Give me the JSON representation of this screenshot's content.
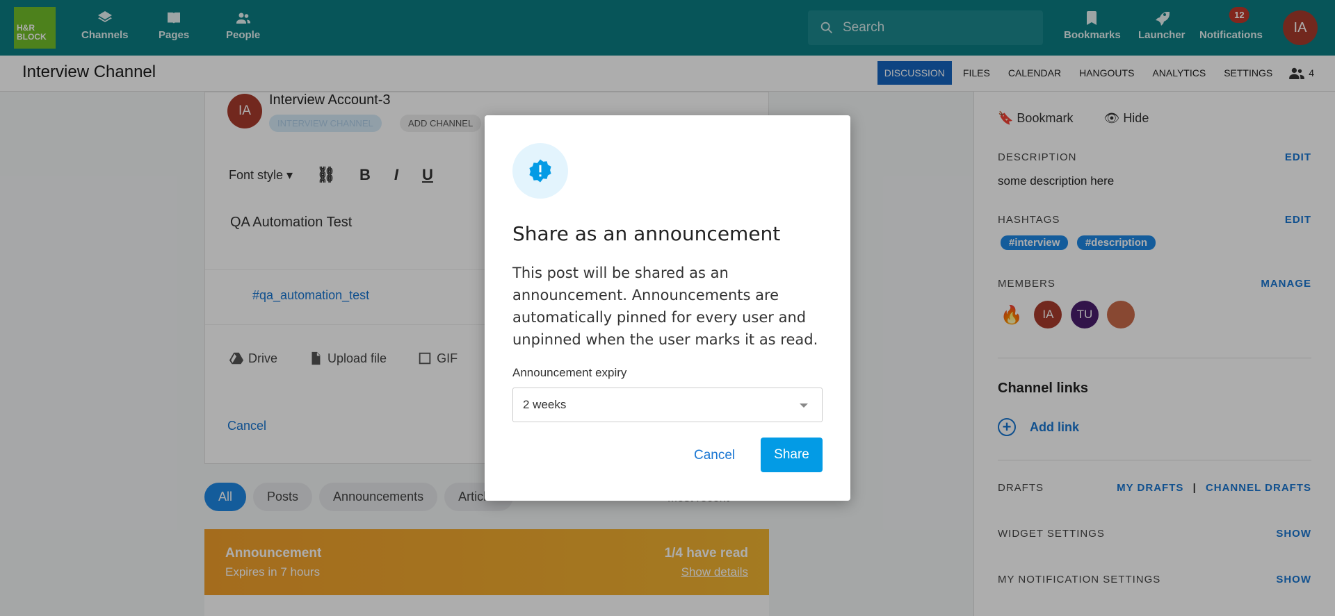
{
  "topbar": {
    "logo_line1": "H&R",
    "logo_line2": "BLOCK",
    "nav": [
      {
        "label": "Channels",
        "icon": "layers-icon"
      },
      {
        "label": "Pages",
        "icon": "book-icon"
      },
      {
        "label": "People",
        "icon": "people-icon"
      }
    ],
    "search_placeholder": "Search",
    "right_nav": [
      {
        "label": "Bookmarks",
        "icon": "bookmark-icon"
      },
      {
        "label": "Launcher",
        "icon": "rocket-icon"
      },
      {
        "label": "Notifications",
        "icon": "bell-icon",
        "badge": "12"
      }
    ],
    "user_initials": "IA"
  },
  "channel": {
    "title": "Interview Channel",
    "tabs": [
      "DISCUSSION",
      "FILES",
      "CALENDAR",
      "HANGOUTS",
      "ANALYTICS",
      "SETTINGS"
    ],
    "active_tab": "DISCUSSION",
    "member_count": "4"
  },
  "composer": {
    "author_initials": "IA",
    "author_name": "Interview Account-3",
    "chip_channel": "INTERVIEW CHANNEL",
    "chip_add": "ADD CHANNEL",
    "font_style": "Font style",
    "text": "QA Automation Test",
    "hashtag": "#qa_automation_test",
    "attachments": [
      "Drive",
      "Upload file",
      "GIF"
    ],
    "cancel": "Cancel"
  },
  "filters": {
    "items": [
      "All",
      "Posts",
      "Announcements",
      "Articles"
    ],
    "active": "All",
    "sort": "Most recent"
  },
  "announcement_card": {
    "title": "Announcement",
    "expires": "Expires in 7 hours",
    "read": "1/4 have read",
    "details": "Show details"
  },
  "sidebar": {
    "bookmark": "Bookmark",
    "hide": "Hide",
    "description_heading": "DESCRIPTION",
    "description_edit": "EDIT",
    "description": "some description here",
    "hashtags_heading": "HASHTAGS",
    "hashtags_edit": "EDIT",
    "hashtags": [
      "#interview",
      "#description"
    ],
    "members_heading": "MEMBERS",
    "members_manage": "MANAGE",
    "members": [
      {
        "initials": "",
        "color": "#ffffff"
      },
      {
        "initials": "IA",
        "color": "#a83b2d"
      },
      {
        "initials": "TU",
        "color": "#4a1e6e"
      },
      {
        "initials": "",
        "color": "#c96a4a"
      }
    ],
    "channel_links": "Channel links",
    "add_link": "Add link",
    "drafts_heading": "DRAFTS",
    "my_drafts": "MY DRAFTS",
    "separator": "|",
    "channel_drafts": "CHANNEL DRAFTS",
    "widget_settings": "WIDGET SETTINGS",
    "widget_show": "SHOW",
    "notification_settings": "MY NOTIFICATION SETTINGS",
    "notification_show": "SHOW"
  },
  "modal": {
    "title": "Share as an announcement",
    "body": "This post will be shared as an announcement. Announcements are automatically pinned for every user and unpinned when the user marks it as read.",
    "expiry_label": "Announcement expiry",
    "expiry_value": "2 weeks",
    "cancel": "Cancel",
    "share": "Share",
    "accent_color": "#039be5"
  }
}
